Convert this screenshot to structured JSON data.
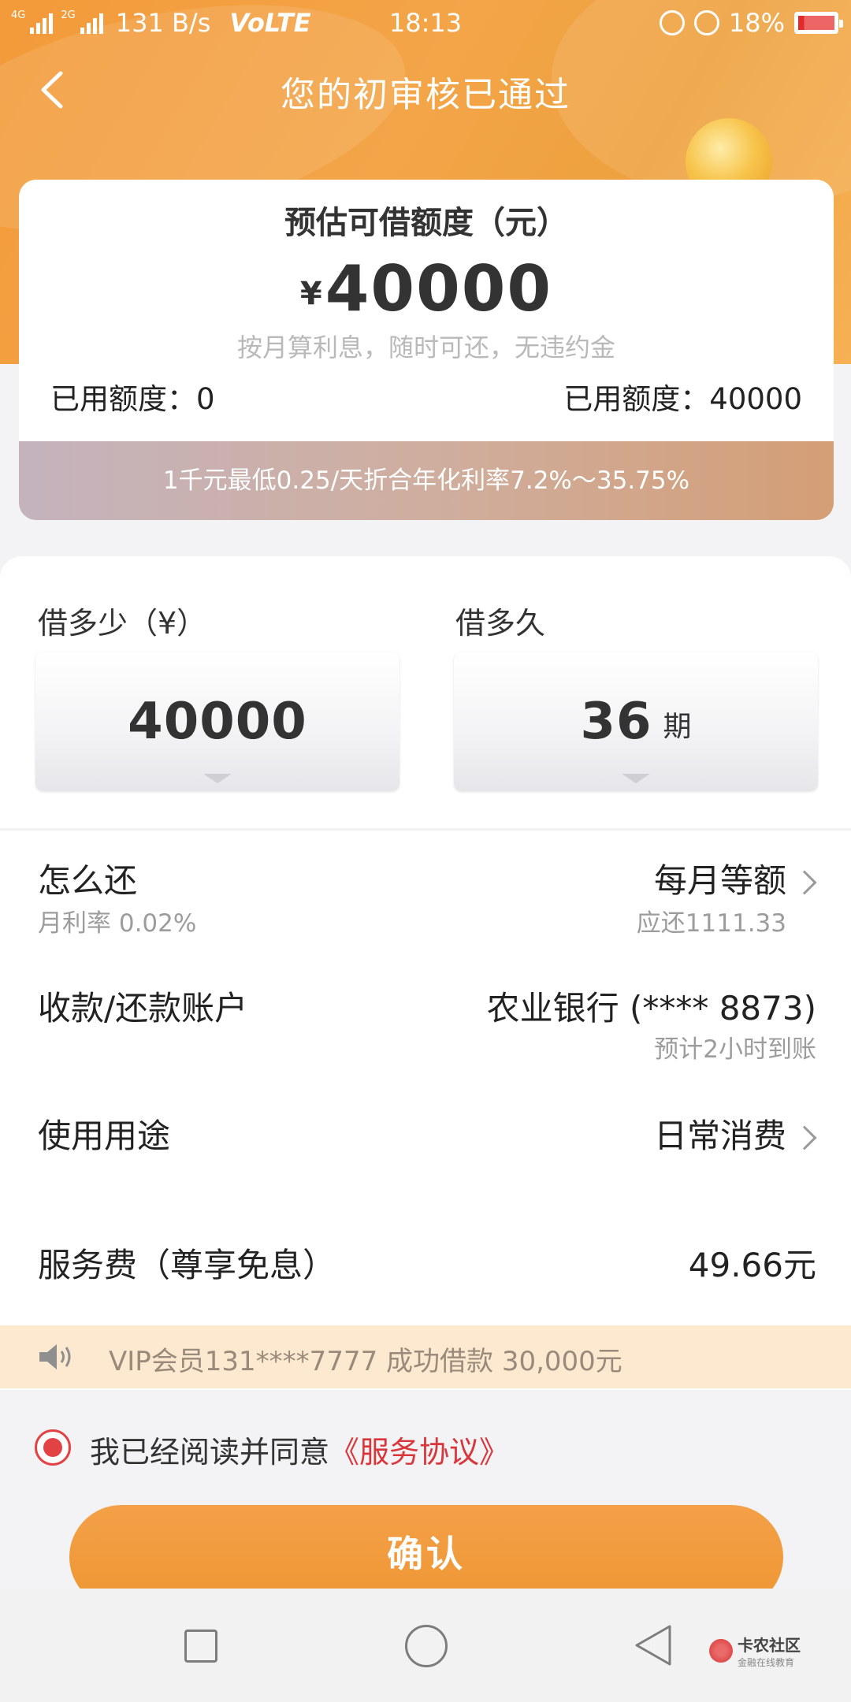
{
  "status_bar": {
    "net1": "4G",
    "net2": "2G",
    "speed": "131 B/s",
    "volte": "VoLTE",
    "time": "18:13",
    "battery": "18%",
    "battery_level": 0.18
  },
  "nav": {
    "title": "您的初审核已通过"
  },
  "limit": {
    "title": "预估可借额度（元）",
    "currency": "¥",
    "amount": "40000",
    "subtitle": "按月算利息，随时可还，无违约金",
    "used_left": "已用额度：0",
    "used_right": "已用额度：40000",
    "rate": "1千元最低0.25/天折合年化利率7.2%～35.75%"
  },
  "loan": {
    "amount_label": "借多少（¥）",
    "amount_value": "40000",
    "term_label": "借多久",
    "term_value": "36",
    "term_unit": "期"
  },
  "rows": {
    "repay_label": "怎么还",
    "repay_sub": "月利率 0.02%",
    "repay_value": "每月等额",
    "repay_sub_value": "应还1111.33",
    "account_label": "收款/还款账户",
    "account_value": "农业银行 (**** 8873)",
    "account_sub": "预计2小时到账",
    "purpose_label": "使用用途",
    "purpose_value": "日常消费",
    "fee_label": "服务费（尊享免息）",
    "fee_value": "49.66元"
  },
  "marquee": {
    "text": "VIP会员131****7777 成功借款 30,000元"
  },
  "agreement": {
    "text": "我已经阅读并同意",
    "link": "《服务协议》"
  },
  "confirm": {
    "label": "确认"
  },
  "watermark": {
    "main": "卡农社区",
    "sub": "金融在线教育"
  },
  "colors": {
    "accent": "#ee9633",
    "link": "#d9363b",
    "rate_banner": "#cfae9f"
  }
}
